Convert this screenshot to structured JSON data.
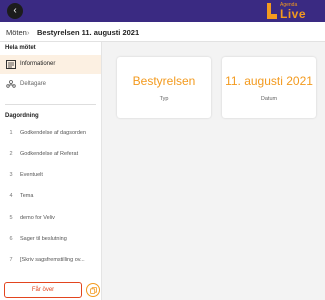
{
  "app": {
    "logo_small": "Agenda",
    "logo_big": "Live",
    "brand_color": "#f39a1e",
    "header_color": "#3a2a82"
  },
  "header": {
    "back_icon": "chevron-left-icon",
    "back_glyph": "‹"
  },
  "breadcrumb": {
    "home": "Möten",
    "separator": "›",
    "current": "Bestyrelsen 11. augusti 2021"
  },
  "sidebar": {
    "meeting_section_title": "Hela mötet",
    "meeting_items": [
      {
        "label": "Informationer",
        "icon": "info-panel-icon",
        "active": true
      },
      {
        "label": "Deltagare",
        "icon": "participants-icon",
        "active": false
      }
    ],
    "agenda_section_title": "Dagordning",
    "agenda_items": [
      {
        "num": "1",
        "label": "Godkendelse af dagsorden"
      },
      {
        "num": "2",
        "label": "Godkendelse af Referat"
      },
      {
        "num": "3",
        "label": "Eventuelt"
      },
      {
        "num": "4",
        "label": "Tema"
      },
      {
        "num": "5",
        "label": "demo for Veliv"
      },
      {
        "num": "6",
        "label": "Sager til beslutning"
      },
      {
        "num": "7",
        "label": "[Skriv sagsfremstilling ov..."
      }
    ],
    "leave_button": "Får över",
    "copy_icon": "copy-icon"
  },
  "main": {
    "cards": [
      {
        "value": "Bestyrelsen",
        "label": "Typ"
      },
      {
        "value": "11. augusti 2021",
        "label": "Datum"
      }
    ]
  }
}
